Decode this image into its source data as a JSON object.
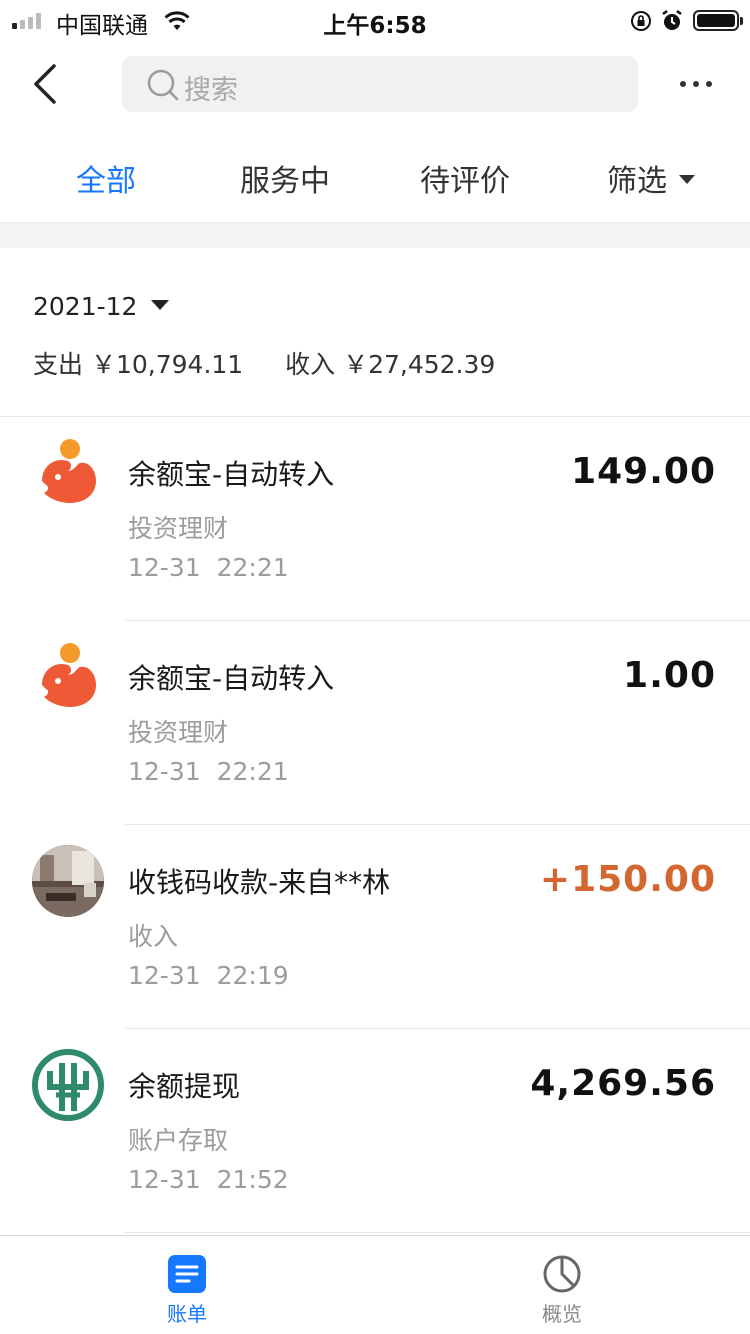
{
  "status_bar": {
    "carrier": "中国联通",
    "time": "上午6:58",
    "signal_bars": 4,
    "signal_active": 1,
    "battery_percent": 100
  },
  "nav": {
    "back_icon": "chevron-left-icon",
    "search_placeholder": "搜索",
    "more_icon": "more-dots-icon"
  },
  "tabs": [
    {
      "label": "全部",
      "active": true
    },
    {
      "label": "服务中",
      "active": false
    },
    {
      "label": "待评价",
      "active": false
    },
    {
      "label": "筛选",
      "active": false
    }
  ],
  "summary": {
    "month": "2021-12",
    "expense_label": "支出",
    "expense_value": "￥10,794.11",
    "income_label": "收入",
    "income_value": "￥27,452.39"
  },
  "transactions": [
    {
      "title": "余额宝-自动转入",
      "category": "投资理财",
      "time": "12-31 22:21",
      "amount": "149.00",
      "logo": "yuebao-logo",
      "is_income": false
    },
    {
      "title": "余额宝-自动转入",
      "category": "投资理财",
      "time": "12-31 22:21",
      "amount": "1.00",
      "logo": "yuebao-logo",
      "is_income": false
    },
    {
      "title": "收钱码收款-来自**林",
      "category": "收入",
      "time": "12-31 22:19",
      "amount": "+150.00",
      "logo": "user-photo-avatar",
      "is_income": true
    },
    {
      "title": "余额提现",
      "category": "账户存取",
      "time": "12-31 21:52",
      "amount": "4,269.56",
      "logo": "agricultural-bank-logo",
      "is_income": false
    }
  ],
  "tabbar": [
    {
      "label": "账单",
      "icon": "bill-icon",
      "active": true
    },
    {
      "label": "概览",
      "icon": "pie-chart-icon",
      "active": false
    }
  ],
  "colors": {
    "accent": "#1677ff",
    "income": "#d4662f",
    "yuebao": "#ef5a36",
    "yuebao_dot": "#f39a2b",
    "abc_green": "#2f8a6a"
  }
}
